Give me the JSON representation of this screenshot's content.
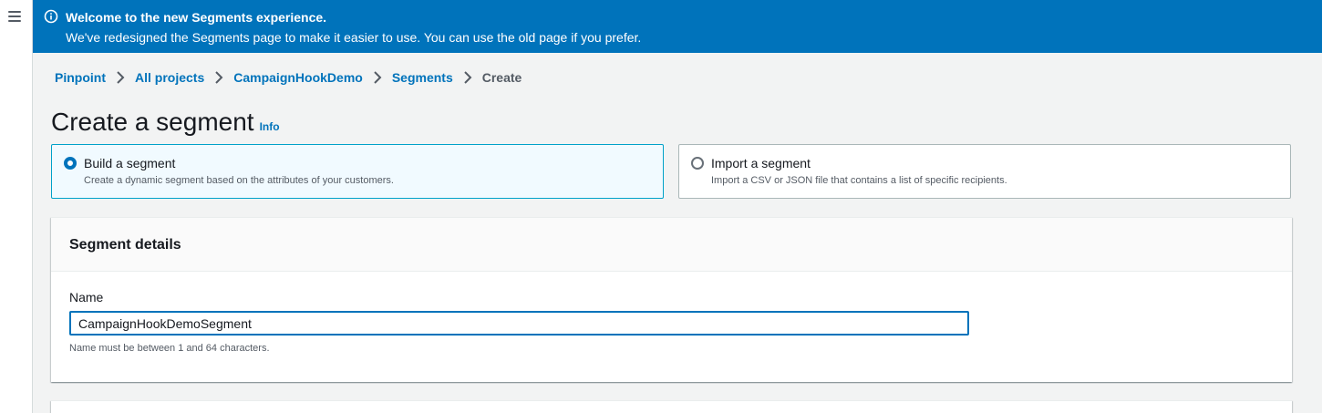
{
  "flash": {
    "title": "Welcome to the new Segments experience.",
    "body": "We've redesigned the Segments page to make it easier to use. You can use the old page if you prefer.",
    "color": "#0073bb",
    "icon": "info-circle-icon"
  },
  "breadcrumb": {
    "items": [
      "Pinpoint",
      "All projects",
      "CampaignHookDemo",
      "Segments"
    ],
    "current": "Create"
  },
  "page": {
    "title": "Create a segment",
    "info_label": "Info"
  },
  "segment_type": {
    "options": [
      {
        "label": "Build a segment",
        "description": "Create a dynamic segment based on the attributes of your customers.",
        "selected": true
      },
      {
        "label": "Import a segment",
        "description": "Import a CSV or JSON file that contains a list of specific recipients.",
        "selected": false
      }
    ]
  },
  "segment_details": {
    "title": "Segment details",
    "name_label": "Name",
    "name_value": "CampaignHookDemoSegment",
    "name_hint": "Name must be between 1 and 64 characters."
  },
  "colors": {
    "accent": "#0073bb",
    "selected_tile_bg": "#f1faff",
    "selected_tile_border": "#00a1c9"
  }
}
